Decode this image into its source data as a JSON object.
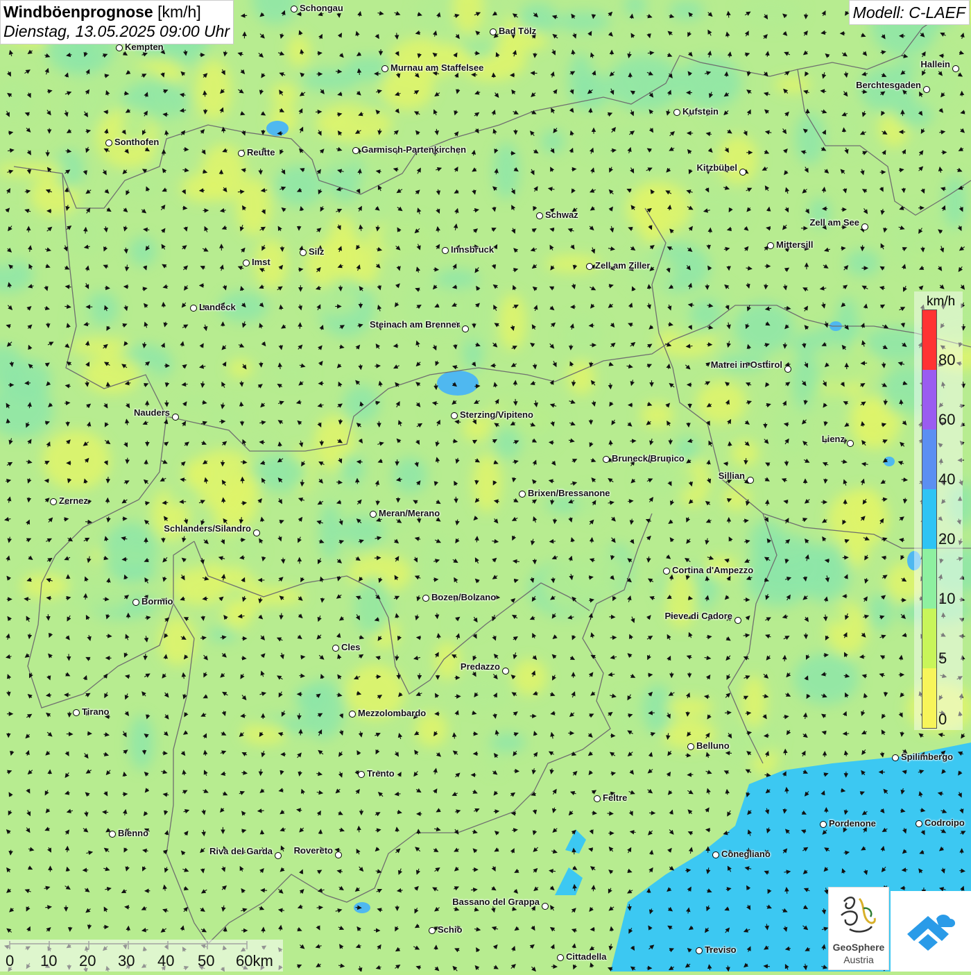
{
  "title": {
    "main": "Windböenprognose",
    "unit": "[km/h]",
    "datetime": "Dienstag, 13.05.2025 09:00 Uhr"
  },
  "model_label": "Modell: C-LAEF",
  "legend": {
    "unit": "km/h",
    "colors": [
      "#ff3333",
      "#9a5cf0",
      "#5b8ff2",
      "#2ec4f4",
      "#8ef0a0",
      "#c8f55a",
      "#f7f55a"
    ],
    "labels": [
      "80",
      "60",
      "40",
      "20",
      "10",
      "5",
      "0"
    ]
  },
  "scale_bar": {
    "labels": [
      "0",
      "10",
      "20",
      "30",
      "40",
      "50",
      "60km"
    ]
  },
  "logo": {
    "name": "GeoSphere",
    "country": "Austria"
  },
  "colors": {
    "field_green": "#b3ec92",
    "field_teal": "#8ee6a8",
    "field_yellow": "#dff56a",
    "sea_blue": "#3cc8f2",
    "lake_blue": "#4fb8f0"
  },
  "places": [
    {
      "name": "Schongau"
    },
    {
      "name": "Bad Tölz"
    },
    {
      "name": "Kempten"
    },
    {
      "name": "Murnau am Staffelsee"
    },
    {
      "name": "Hallein"
    },
    {
      "name": "Berchtesgaden"
    },
    {
      "name": "Kufstein"
    },
    {
      "name": "Sonthofen"
    },
    {
      "name": "Reutte"
    },
    {
      "name": "Garmisch-Partenkirchen"
    },
    {
      "name": "Kitzbühel"
    },
    {
      "name": "Schwaz"
    },
    {
      "name": "Zell am See"
    },
    {
      "name": "Mittersill"
    },
    {
      "name": "Innsbruck"
    },
    {
      "name": "Silz"
    },
    {
      "name": "Imst"
    },
    {
      "name": "Zell am Ziller"
    },
    {
      "name": "Landeck"
    },
    {
      "name": "Steinach am Brenner"
    },
    {
      "name": "Matrei in Osttirol"
    },
    {
      "name": "Nauders"
    },
    {
      "name": "Sterzing/Vipiteno"
    },
    {
      "name": "Lienz"
    },
    {
      "name": "Bruneck/Brunico"
    },
    {
      "name": "Sillian"
    },
    {
      "name": "Brixen/Bressanone"
    },
    {
      "name": "Zernez"
    },
    {
      "name": "Meran/Merano"
    },
    {
      "name": "Schlanders/Silandro"
    },
    {
      "name": "Cortina d'Ampezzo"
    },
    {
      "name": "Bozen/Bolzano"
    },
    {
      "name": "Bormio"
    },
    {
      "name": "Pieve di Cadore"
    },
    {
      "name": "Cles"
    },
    {
      "name": "Predazzo"
    },
    {
      "name": "Tirano"
    },
    {
      "name": "Mezzolombardo"
    },
    {
      "name": "Belluno"
    },
    {
      "name": "Spilimbergo"
    },
    {
      "name": "Trento"
    },
    {
      "name": "Feltre"
    },
    {
      "name": "Pordenone"
    },
    {
      "name": "Codroipo"
    },
    {
      "name": "Bienno"
    },
    {
      "name": "Riva del Garda"
    },
    {
      "name": "Rovereto"
    },
    {
      "name": "Conegliano"
    },
    {
      "name": "Bassano del Grappa"
    },
    {
      "name": "Schio"
    },
    {
      "name": "Treviso"
    },
    {
      "name": "Cittadella"
    }
  ]
}
